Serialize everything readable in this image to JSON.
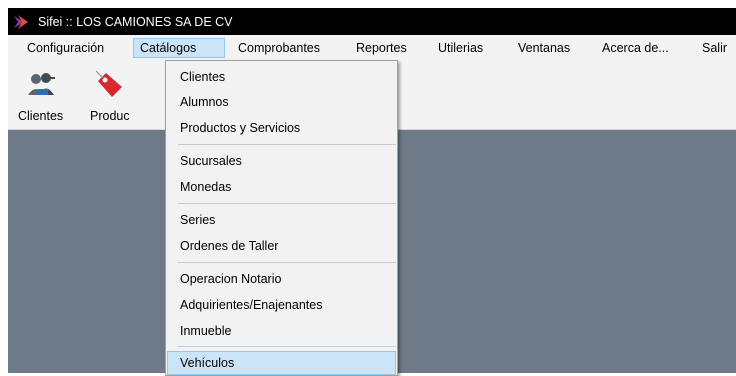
{
  "window": {
    "title": "Sifei :: LOS CAMIONES SA DE CV",
    "accent_colors": [
      "#e8473b",
      "#7b3fb0"
    ]
  },
  "menubar": {
    "items": [
      "Configuración",
      "Catálogos",
      "Comprobantes",
      "Reportes",
      "Utilerias",
      "Ventanas",
      "Acerca de...",
      "Salir"
    ],
    "open_item": "Catálogos"
  },
  "toolbar": {
    "buttons": [
      {
        "label": "Clientes",
        "icon": "users-icon"
      },
      {
        "label": "Produc",
        "icon": "price-tag-icon"
      }
    ]
  },
  "catalogos_menu": {
    "items": [
      "Clientes",
      "Alumnos",
      "Productos y Servicios",
      "Sucursales",
      "Monedas",
      "Series",
      "Ordenes de Taller",
      "Operacion Notario",
      "Adquirientes/Enajenantes",
      "Inmueble",
      "Vehículos"
    ],
    "separators_after": [
      "Productos y Servicios",
      "Monedas",
      "Ordenes de Taller",
      "Inmueble"
    ],
    "highlighted": "Vehículos"
  },
  "colors": {
    "workspace": "#6e7a87",
    "menu_highlight": "#cce4f7",
    "titlebar": "#000000"
  }
}
